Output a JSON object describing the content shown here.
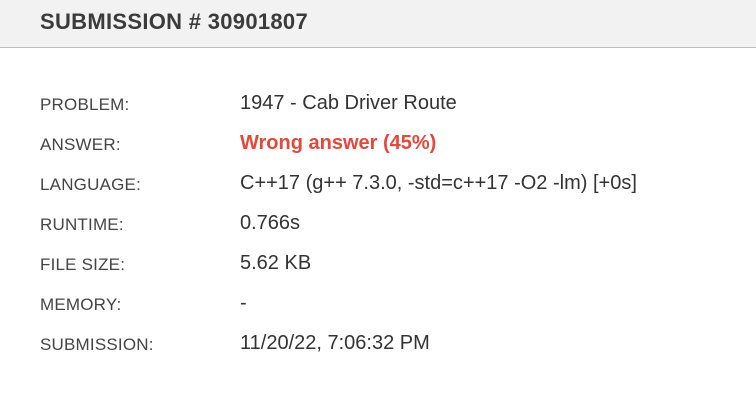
{
  "header": {
    "title": "SUBMISSION # 30901807"
  },
  "details": [
    {
      "label": "PROBLEM:",
      "value": "1947 - Cab Driver Route"
    },
    {
      "label": "ANSWER:",
      "value": "Wrong answer (45%)"
    },
    {
      "label": "LANGUAGE:",
      "value": "C++17 (g++ 7.3.0, -std=c++17 -O2 -lm) [+0s]"
    },
    {
      "label": "RUNTIME:",
      "value": "0.766s"
    },
    {
      "label": "FILE SIZE:",
      "value": "5.62 KB"
    },
    {
      "label": "MEMORY:",
      "value": "-"
    },
    {
      "label": "SUBMISSION:",
      "value": "11/20/22, 7:06:32 PM"
    }
  ],
  "colors": {
    "header_bg": "#f2f2f2",
    "wrong_answer": "#e2493b",
    "text": "#333333"
  }
}
